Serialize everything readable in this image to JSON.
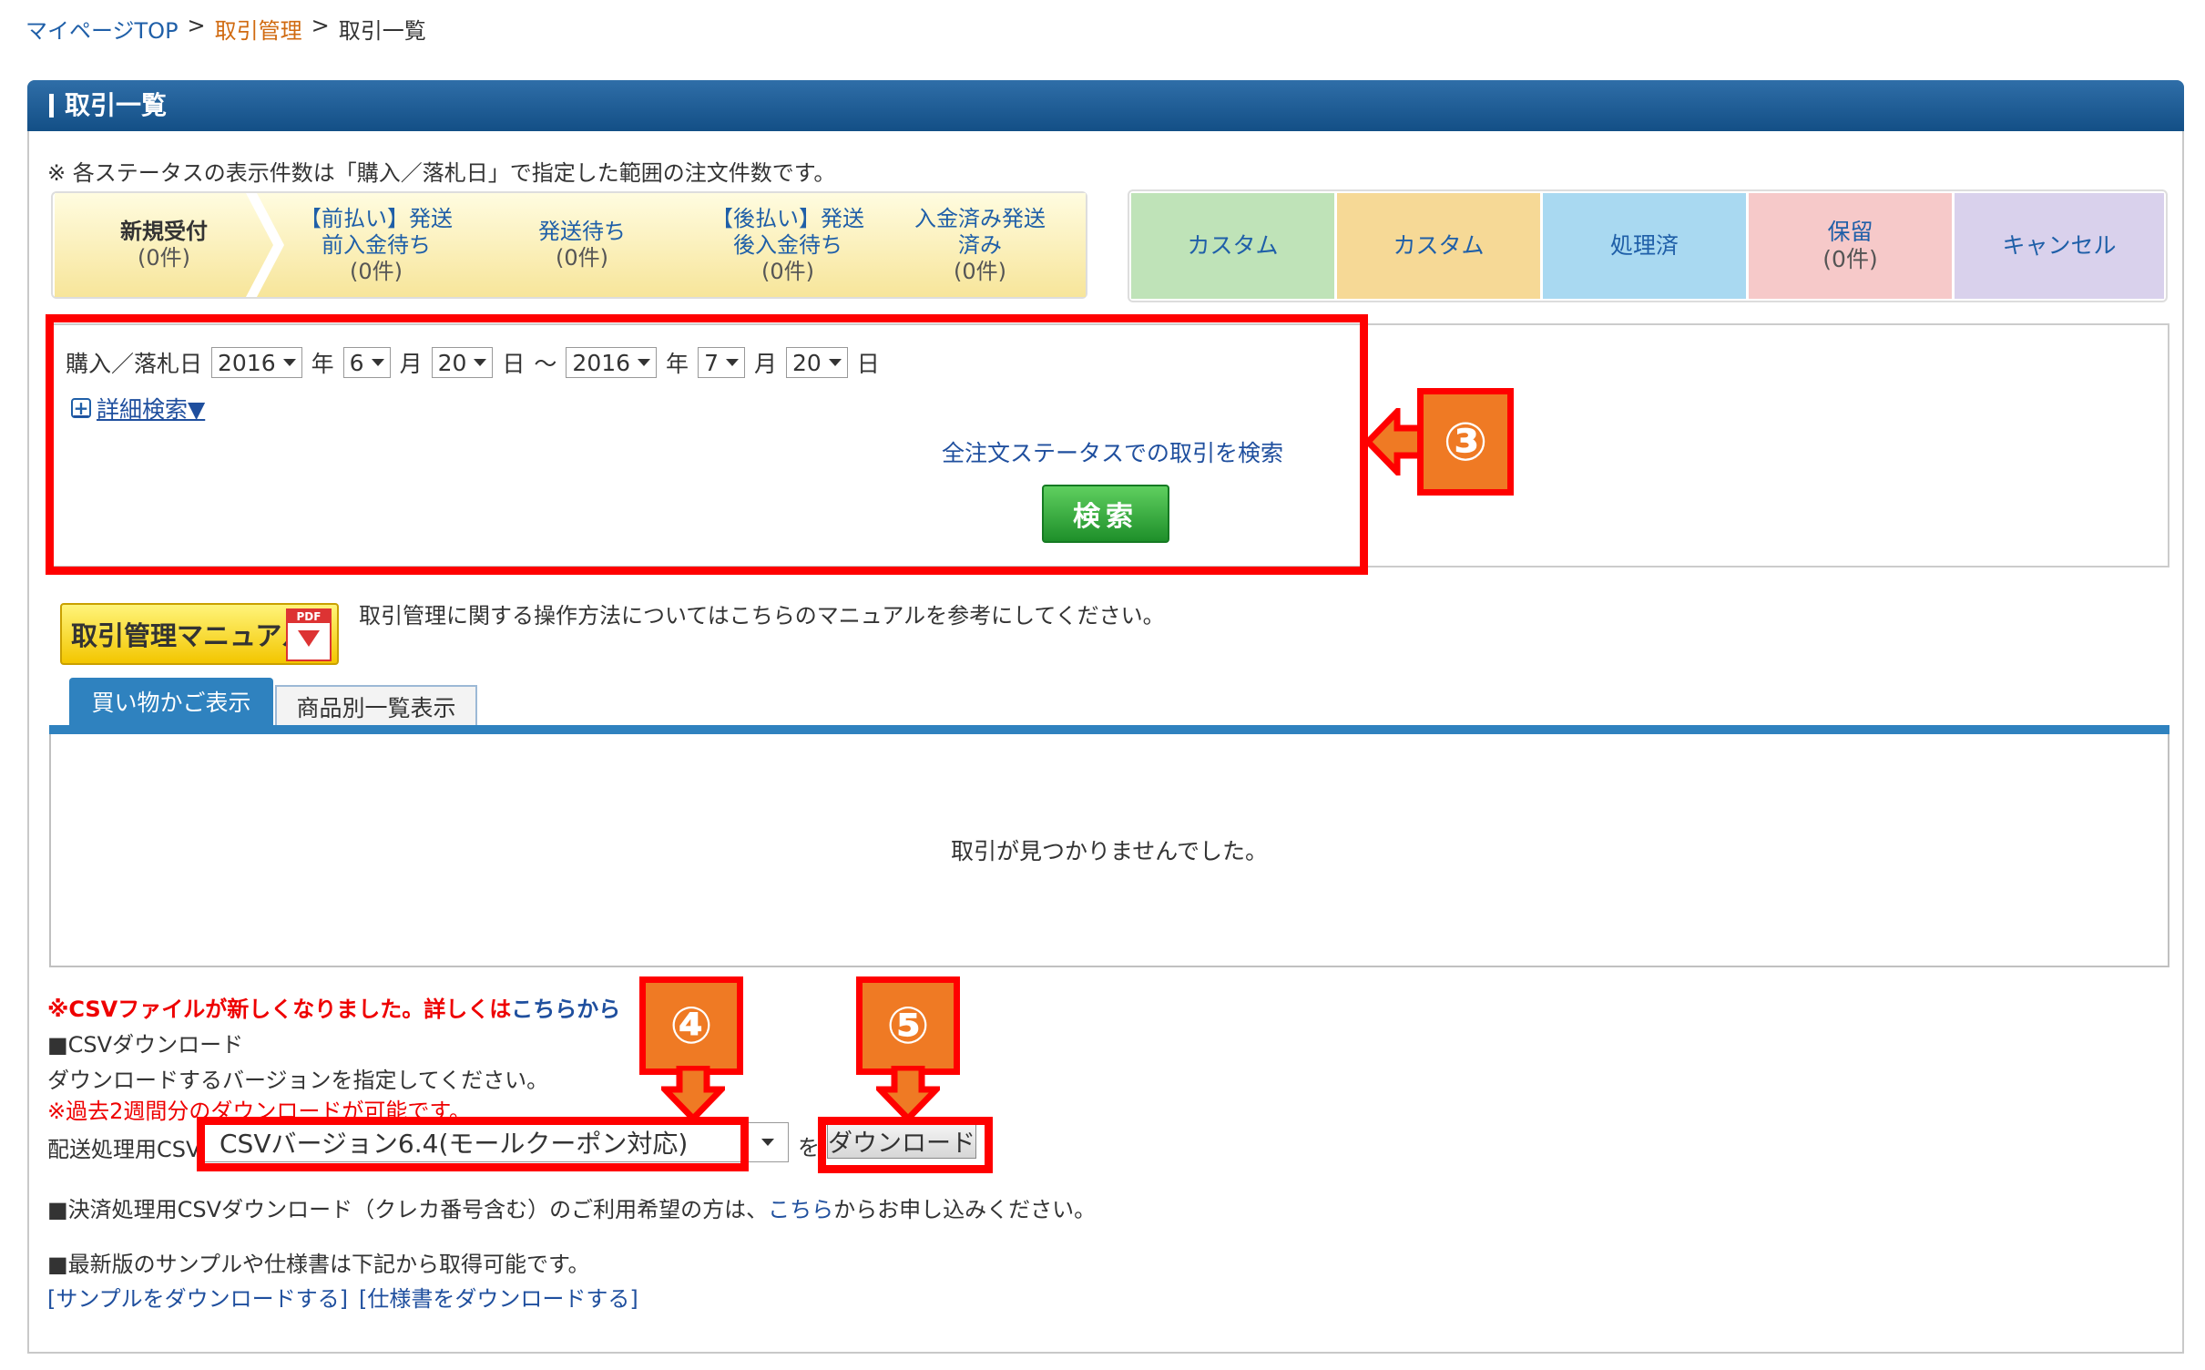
{
  "breadcrumb": {
    "home": "マイページTOP",
    "sep1": ">",
    "parent": "取引管理",
    "sep2": ">",
    "current": "取引一覧"
  },
  "page_title": "取引一覧",
  "status_note": "※ 各ステータスの表示件数は「購入／落札日」で指定した範囲の注文件数です。",
  "status_steps": [
    {
      "label": "新規受付",
      "count": "(0件)"
    },
    {
      "label": "【前払い】発送\n前入金待ち",
      "count": "(0件)"
    },
    {
      "label": "発送待ち",
      "count": "(0件)"
    },
    {
      "label": "【後払い】発送\n後入金待ち",
      "count": "(0件)"
    },
    {
      "label": "入金済み発送\n済み",
      "count": "(0件)"
    }
  ],
  "custom_buttons": [
    {
      "label": "カスタム",
      "count": "",
      "color": "#bfe3b8"
    },
    {
      "label": "カスタム",
      "count": "",
      "color": "#f6d996"
    },
    {
      "label": "処理済",
      "count": "",
      "color": "#a9d9f1"
    },
    {
      "label": "保留",
      "count": "(0件)",
      "color": "#f6c9c9"
    },
    {
      "label": "キャンセル",
      "count": "",
      "color": "#d9d1ec"
    }
  ],
  "search": {
    "date_label": "購入／落札日",
    "from_year": "2016",
    "from_month": "6",
    "from_day": "20",
    "to_year": "2016",
    "to_month": "7",
    "to_day": "20",
    "unit_year": "年",
    "unit_month": "月",
    "unit_day": "日",
    "tilde": "～",
    "detail_link": "詳細検索▼",
    "all_status_link": "全注文ステータスでの取引を検索",
    "search_button": "検索"
  },
  "annotations": {
    "step3": "③",
    "step4": "④",
    "step5": "⑤"
  },
  "manual": {
    "button": "取引管理マニュアル",
    "pdf": "PDF",
    "text": "取引管理に関する操作方法についてはこちらのマニュアルを参考にしてください。"
  },
  "tabs": [
    {
      "label": "買い物かご表示"
    },
    {
      "label": "商品別一覧表示"
    }
  ],
  "result_message": "取引が見つかりませんでした。",
  "csv": {
    "new_notice": "※CSVファイルが新しくなりました。詳しくは",
    "new_notice_link": "こちらから",
    "heading": "■CSVダウンロード",
    "instruction": "ダウンロードするバージョンを指定してください。",
    "period_note": "※過去2週間分のダウンロードが可能です。",
    "select_label": "配送処理用CSV",
    "selected_version": "CSVバージョン6.4(モールクーポン対応)",
    "wo": "を",
    "download_button": "ダウンロード",
    "payment_text_prefix": "■決済処理用CSVダウンロード（クレカ番号含む）のご利用希望の方は、",
    "payment_link": "こちら",
    "payment_text_suffix": "からお申し込みください。",
    "latest_text": "■最新版のサンプルや仕様書は下記から取得可能です。",
    "sample_link": "[サンプルをダウンロードする]",
    "spec_link": "[仕様書をダウンロードする]"
  }
}
